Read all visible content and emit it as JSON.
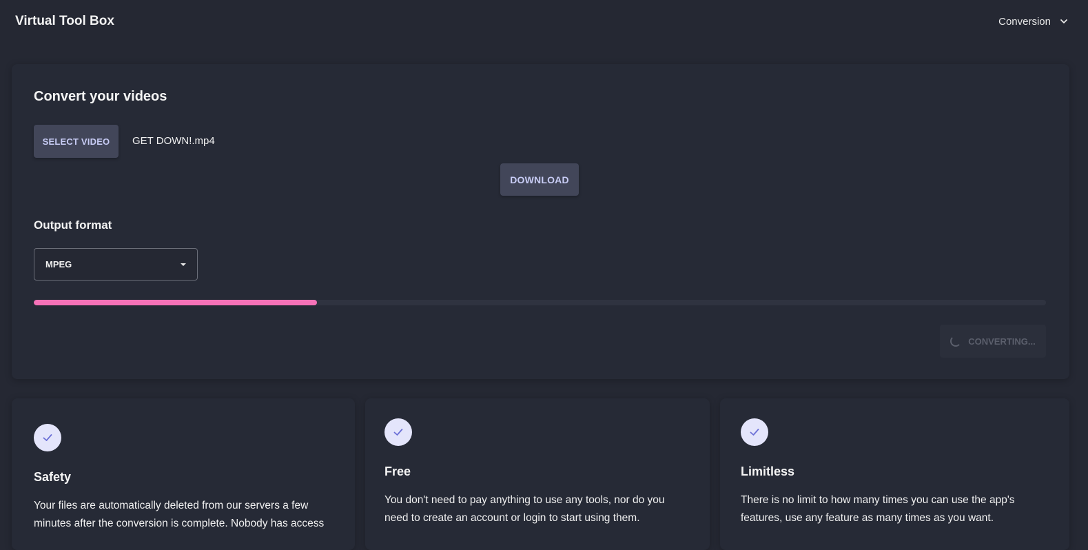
{
  "app": {
    "brand": "Virtual Tool Box"
  },
  "nav": {
    "menu_label": "Conversion"
  },
  "converter": {
    "title": "Convert your videos",
    "select_video_label": "SELECT VIDEO",
    "file_name": "GET DOWN!.mp4",
    "download_label": "DOWNLOAD",
    "output_format_label": "Output format",
    "selected_format": "MPEG",
    "progress_fraction": 0.28,
    "converting_label": "CONVERTING..."
  },
  "features": [
    {
      "title": "Safety",
      "text": "Your files are automatically deleted from our servers a few minutes after the conversion is complete. Nobody has access"
    },
    {
      "title": "Free",
      "text": "You don't need to pay anything to use any tools, nor do you need to create an account or login to start using them."
    },
    {
      "title": "Limitless",
      "text": "There is no limit to how many times you can use the app's features, use any feature as many times as you want."
    }
  ],
  "colors": {
    "background": "#252833",
    "card": "#262a36",
    "button": "#424659",
    "button_text": "#c9cdf6",
    "progress": "#f672b8",
    "check_bg": "#e4e5fb",
    "check_mark": "#6b6fd6"
  }
}
